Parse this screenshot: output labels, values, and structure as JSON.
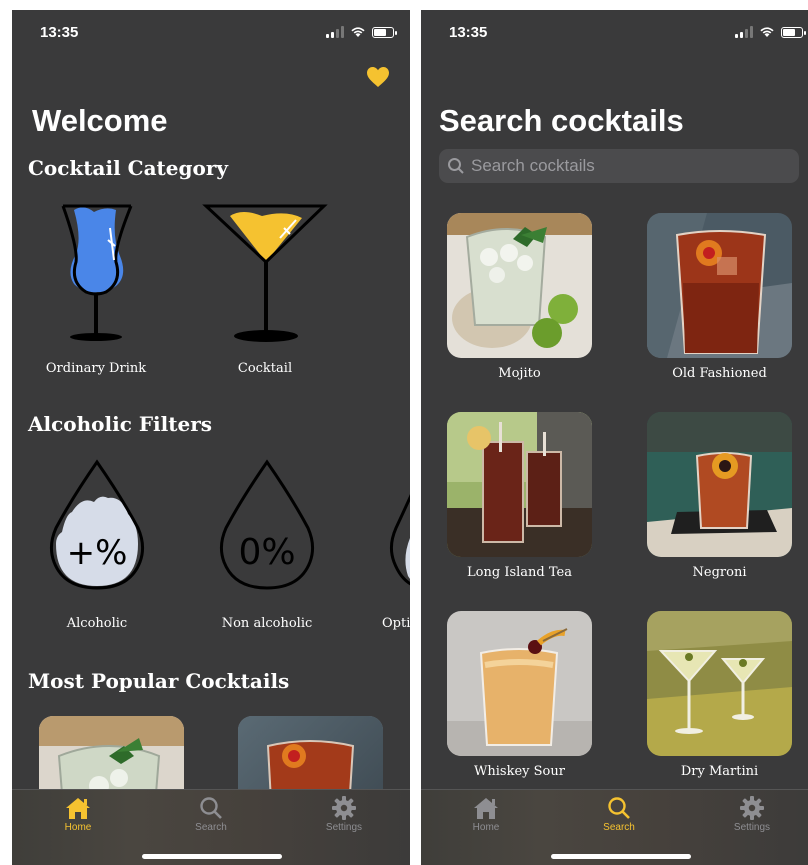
{
  "status": {
    "time": "13:35"
  },
  "home": {
    "title": "Welcome",
    "category_section": "Cocktail Category",
    "categories": [
      {
        "label": "Ordinary Drink",
        "icon": "highball-glass-icon",
        "color": "#4a86e8"
      },
      {
        "label": "Cocktail",
        "icon": "martini-glass-icon",
        "color": "#f5c230"
      }
    ],
    "filters_section": "Alcoholic Filters",
    "filters": [
      {
        "label": "Alcoholic",
        "glyph": "+%"
      },
      {
        "label": "Non alcoholic",
        "glyph": "0%"
      },
      {
        "label": "Opti"
      }
    ],
    "popular_section": "Most Popular Cocktails"
  },
  "search_screen": {
    "title": "Search cocktails",
    "placeholder": "Search cocktails",
    "results": [
      {
        "name": "Mojito"
      },
      {
        "name": "Old Fashioned"
      },
      {
        "name": "Long Island Tea"
      },
      {
        "name": "Negroni"
      },
      {
        "name": "Whiskey Sour"
      },
      {
        "name": "Dry Martini"
      }
    ]
  },
  "tabbar": {
    "home": "Home",
    "search": "Search",
    "settings": "Settings"
  },
  "colors": {
    "accent": "#f5c230",
    "background": "#3a3a3b",
    "inactive": "#8e8e92"
  }
}
